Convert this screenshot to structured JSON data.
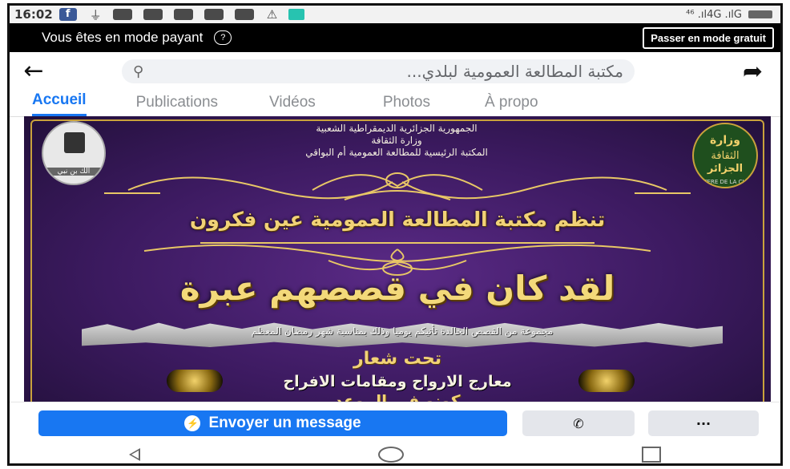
{
  "status_bar": {
    "time": "16:02",
    "fb_badge": "f",
    "signal": "⁴⁶ .ıl4G .ılG"
  },
  "mode_bar": {
    "text": "Vous êtes en mode payant",
    "help_label": "?",
    "free_button": "Passer en mode gratuit"
  },
  "search": {
    "query": "مكتبة المطالعة العمومية لبلدي..."
  },
  "tabs": [
    {
      "label": "Accueil",
      "active": true
    },
    {
      "label": "Publications"
    },
    {
      "label": "Vidéos"
    },
    {
      "label": "Photos"
    },
    {
      "label": "À propo"
    }
  ],
  "poster": {
    "header_lines": [
      "الجمهورية الجزائرية الديمقراطية الشعبية",
      "وزارة الثقافة",
      "المكتبة الرئيسية للمطالعة العمومية أم البواقي"
    ],
    "logo_left_caption": "الك بن نبي",
    "logo_right_lines": [
      "وزارة",
      "الثقافة",
      "الجزائر",
      "TERE DE LA CU"
    ],
    "organizer": "تنظم مكتبة المطالعة العمومية عين فكرون",
    "headline": "لقد كان في قصصهم عبرة",
    "banner": "مجموعة من القصص الخالدة تأتيكم يوميا وذلك بمناسبة شهر رمضان المعظم",
    "slogan_label": "تحت شعار",
    "slogan": "معارج الارواح ومقامات الافراح",
    "closing": "كونو في الموعد"
  },
  "actions": {
    "message_button": "Envoyer un message",
    "more_button": "···"
  },
  "colors": {
    "accent": "#1877f2",
    "poster_purple": "#3c1a60",
    "gold": "#f1d277"
  }
}
